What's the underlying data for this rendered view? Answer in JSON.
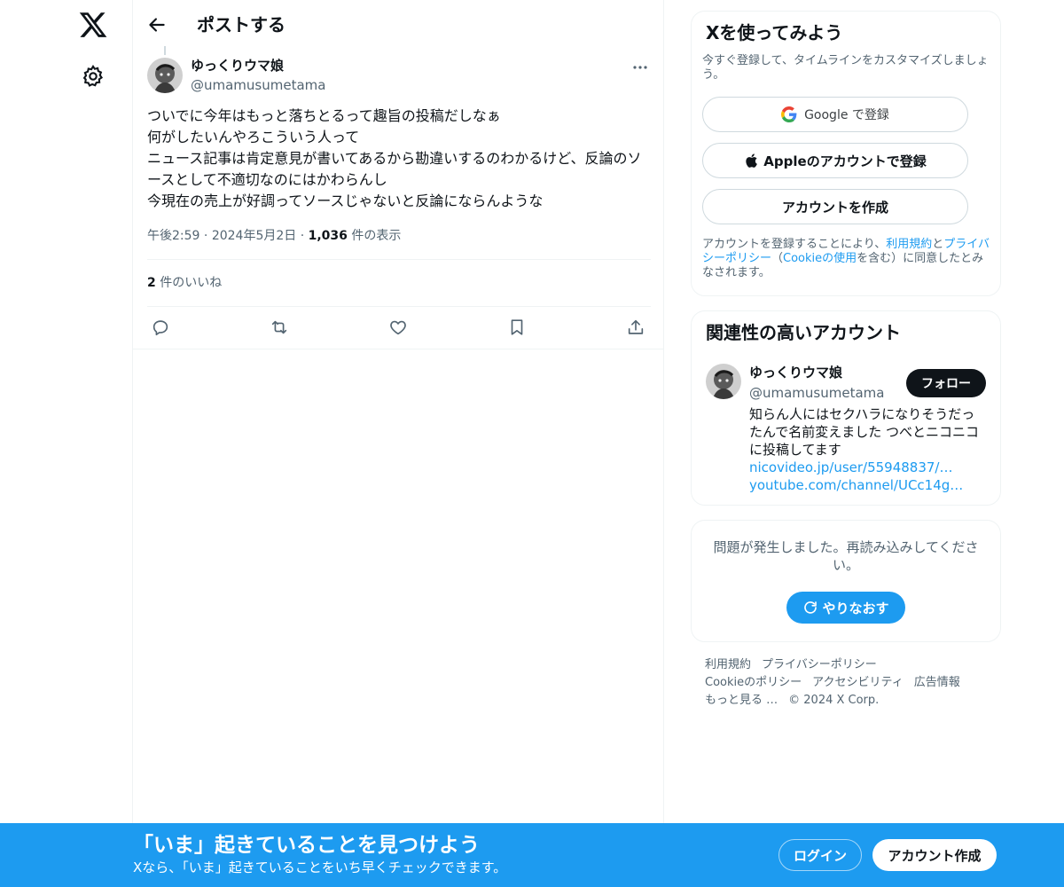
{
  "header": {
    "title": "ポストする"
  },
  "tweet": {
    "author_name": "ゆっくりウマ娘",
    "author_handle": "@umamusumetama",
    "text": "ついでに今年はもっと落ちとるって趣旨の投稿だしなぁ\n何がしたいんやろこういう人って\nニュース記事は肯定意見が書いてあるから勘違いするのわかるけど、反論のソースとして不適切なのにはかわらんし\n今現在の売上が好調ってソースじゃないと反論にならんような",
    "time": "午後2:59",
    "date": "2024年5月2日",
    "views_count": "1,036",
    "views_label": "件の表示",
    "likes_count": "2",
    "likes_label": "件のいいね"
  },
  "signup": {
    "title": "Xを使ってみよう",
    "subtitle": "今すぐ登録して、タイムラインをカスタマイズしましょう。",
    "google_label": "Google で登録",
    "apple_label": "Appleのアカウントで登録",
    "create_label": "アカウントを作成",
    "terms_prefix": "アカウントを登録することにより、",
    "terms_link": "利用規約",
    "terms_and": "と",
    "privacy_link": "プライバシーポリシー",
    "cookie_open": "（",
    "cookie_link": "Cookieの使用",
    "cookie_suffix": "を含む）に同意したとみなされます。"
  },
  "related": {
    "title": "関連性の高いアカウント",
    "name": "ゆっくりウマ娘",
    "handle": "@umamusumetama",
    "follow_label": "フォロー",
    "bio": "知らん人にはセクハラになりそうだったんで名前変えました つべとニコニコに投稿してます",
    "link1": "nicovideo.jp/user/55948837/…",
    "link2": "youtube.com/channel/UCc14g…"
  },
  "error": {
    "message": "問題が発生しました。再読み込みしてください。",
    "retry_label": "やりなおす"
  },
  "footer": {
    "terms": "利用規約",
    "privacy": "プライバシーポリシー",
    "cookie": "Cookieのポリシー",
    "accessibility": "アクセシビリティ",
    "ads": "広告情報",
    "more": "もっと見る …",
    "copyright": "© 2024 X Corp."
  },
  "banner": {
    "title": "「いま」起きていることを見つけよう",
    "subtitle": "Xなら、「いま」起きていることをいち早くチェックできます。",
    "login_label": "ログイン",
    "signup_label": "アカウント作成"
  },
  "colors": {
    "accent": "#1d9bf0",
    "text": "#0f1419",
    "secondary": "#536471",
    "border": "#eff3f4"
  },
  "icons": [
    "x-logo-icon",
    "gear-icon",
    "back-arrow-icon",
    "more-icon",
    "reply-icon",
    "retweet-icon",
    "like-icon",
    "bookmark-icon",
    "share-icon",
    "google-icon",
    "apple-icon",
    "refresh-icon"
  ]
}
